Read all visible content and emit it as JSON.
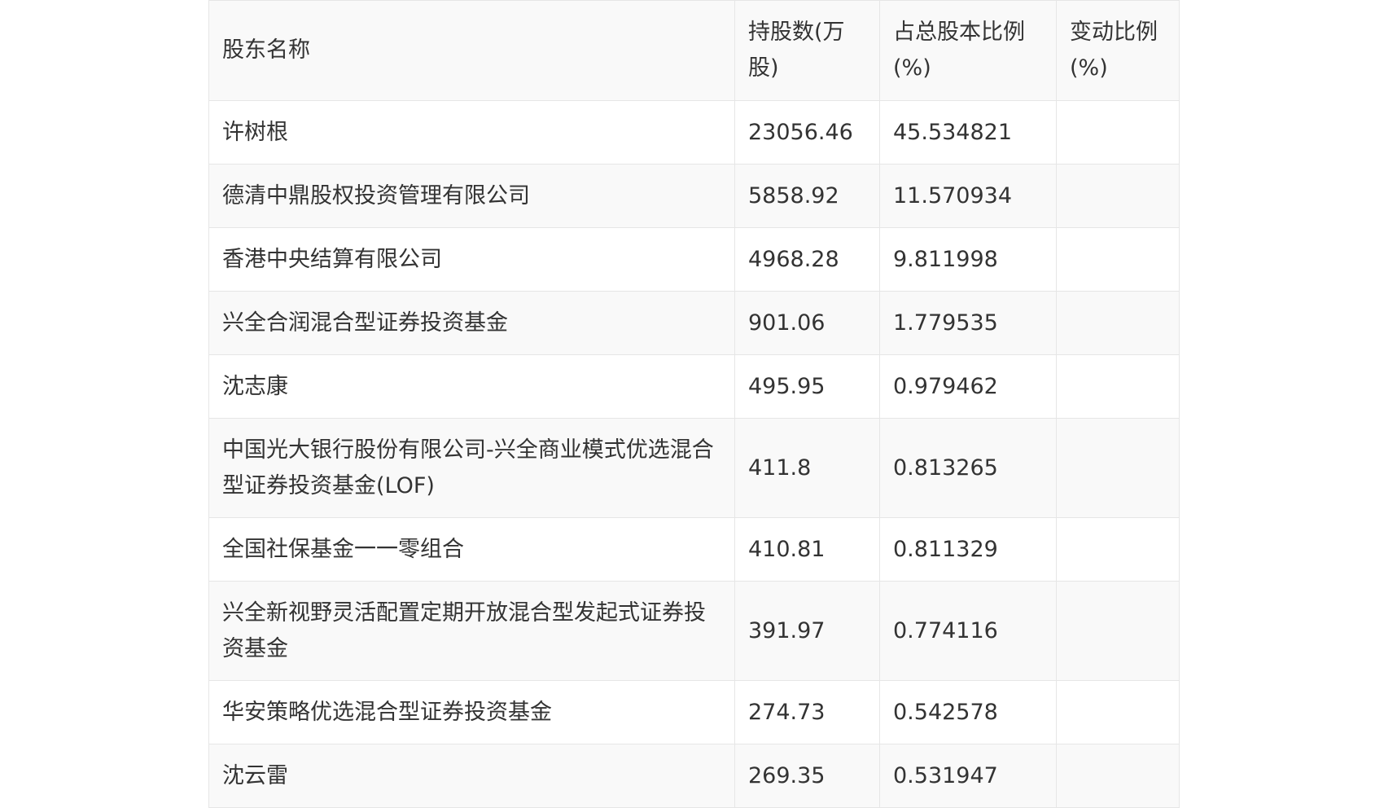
{
  "table": {
    "headers": [
      "股东名称",
      "持股数(万股)",
      "占总股本比例(%)",
      "变动比例(%)"
    ],
    "rows": [
      {
        "name": "许树根",
        "shares": "23056.46",
        "ratio": "45.534821",
        "change": ""
      },
      {
        "name": "德清中鼎股权投资管理有限公司",
        "shares": "5858.92",
        "ratio": "11.570934",
        "change": ""
      },
      {
        "name": "香港中央结算有限公司",
        "shares": "4968.28",
        "ratio": "9.811998",
        "change": ""
      },
      {
        "name": "兴全合润混合型证券投资基金",
        "shares": "901.06",
        "ratio": "1.779535",
        "change": ""
      },
      {
        "name": "沈志康",
        "shares": "495.95",
        "ratio": "0.979462",
        "change": ""
      },
      {
        "name": "中国光大银行股份有限公司-兴全商业模式优选混合型证券投资基金(LOF)",
        "shares": "411.8",
        "ratio": "0.813265",
        "change": ""
      },
      {
        "name": "全国社保基金一一零组合",
        "shares": "410.81",
        "ratio": "0.811329",
        "change": ""
      },
      {
        "name": "兴全新视野灵活配置定期开放混合型发起式证券投资基金",
        "shares": "391.97",
        "ratio": "0.774116",
        "change": ""
      },
      {
        "name": "华安策略优选混合型证券投资基金",
        "shares": "274.73",
        "ratio": "0.542578",
        "change": ""
      },
      {
        "name": "沈云雷",
        "shares": "269.35",
        "ratio": "0.531947",
        "change": ""
      }
    ]
  }
}
